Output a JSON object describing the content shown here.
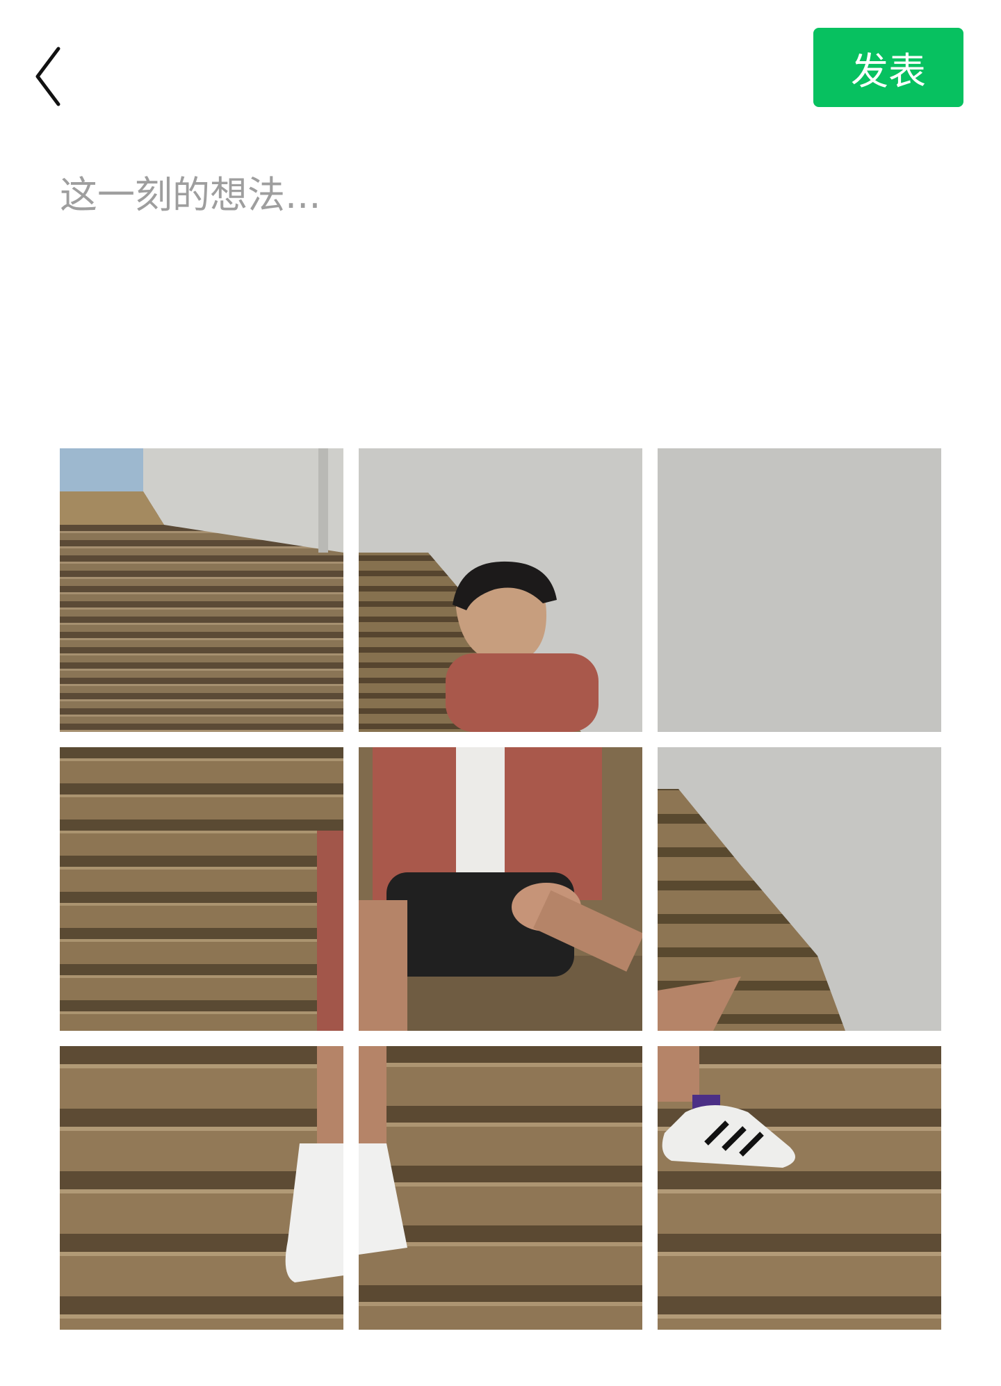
{
  "header": {
    "back_icon": "chevron-left-icon",
    "publish_label": "发表",
    "accent_color": "#07c160"
  },
  "composer": {
    "placeholder": "这一刻的想法..."
  },
  "photos": {
    "count": 9,
    "tiles": [
      {
        "label": "photo-1"
      },
      {
        "label": "photo-2"
      },
      {
        "label": "photo-3"
      },
      {
        "label": "photo-4"
      },
      {
        "label": "photo-5"
      },
      {
        "label": "photo-6"
      },
      {
        "label": "photo-7"
      },
      {
        "label": "photo-8"
      },
      {
        "label": "photo-9"
      }
    ]
  }
}
